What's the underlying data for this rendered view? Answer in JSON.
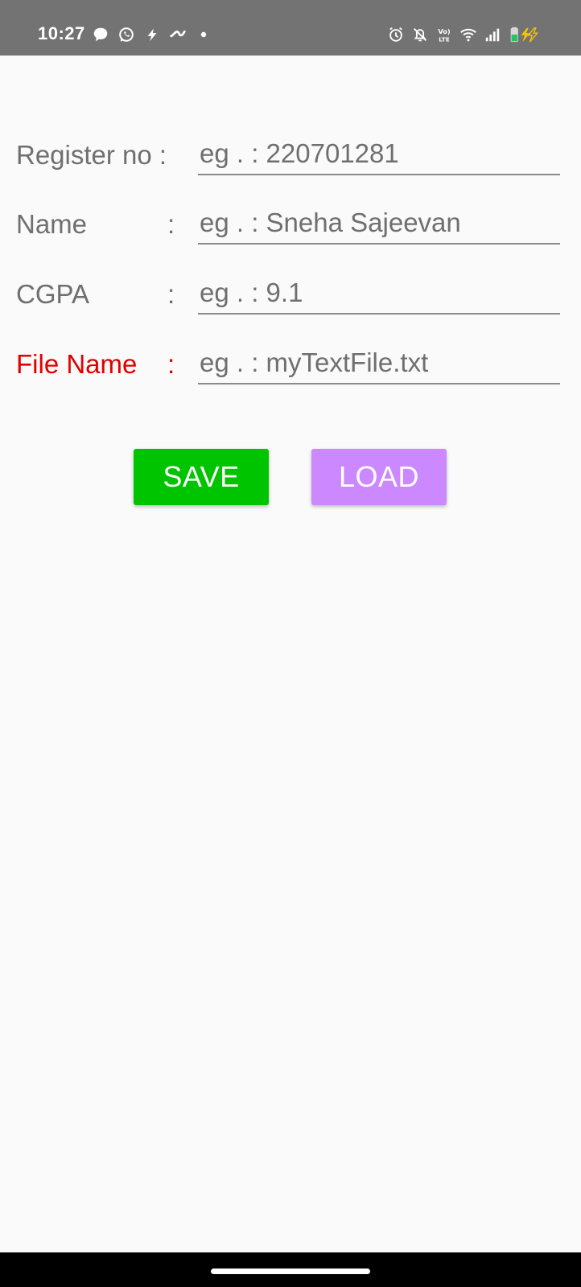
{
  "status_bar": {
    "time": "10:27",
    "left_icons": [
      "chat-bubble-icon",
      "whatsapp-icon",
      "bolt-icon",
      "app-icon",
      "dot-icon"
    ],
    "right_icons": [
      "alarm-icon",
      "bell-off-icon",
      "volte-icon",
      "wifi-icon",
      "signal-icon",
      "battery-charging-icon"
    ],
    "volte_text": "Vo) LTE",
    "background": "#737373"
  },
  "form": {
    "fields": [
      {
        "label": "Register no :",
        "colon": "",
        "placeholder": "eg . : 220701281",
        "color": "#6f6f6f"
      },
      {
        "label": "Name",
        "colon": ":",
        "placeholder": "eg . : Sneha Sajeevan",
        "color": "#6f6f6f"
      },
      {
        "label": "CGPA",
        "colon": ":",
        "placeholder": "eg . : 9.1",
        "color": "#6f6f6f"
      },
      {
        "label": "File Name",
        "colon": ":",
        "placeholder": "eg . : myTextFile.txt",
        "color": "#e00000"
      }
    ]
  },
  "buttons": {
    "save": {
      "label": "SAVE",
      "color": "#00c400"
    },
    "load": {
      "label": "LOAD",
      "color": "#cc88ff"
    }
  },
  "colors": {
    "background": "#fafafa",
    "label_gray": "#6f6f6f",
    "accent_red": "#e00000"
  }
}
